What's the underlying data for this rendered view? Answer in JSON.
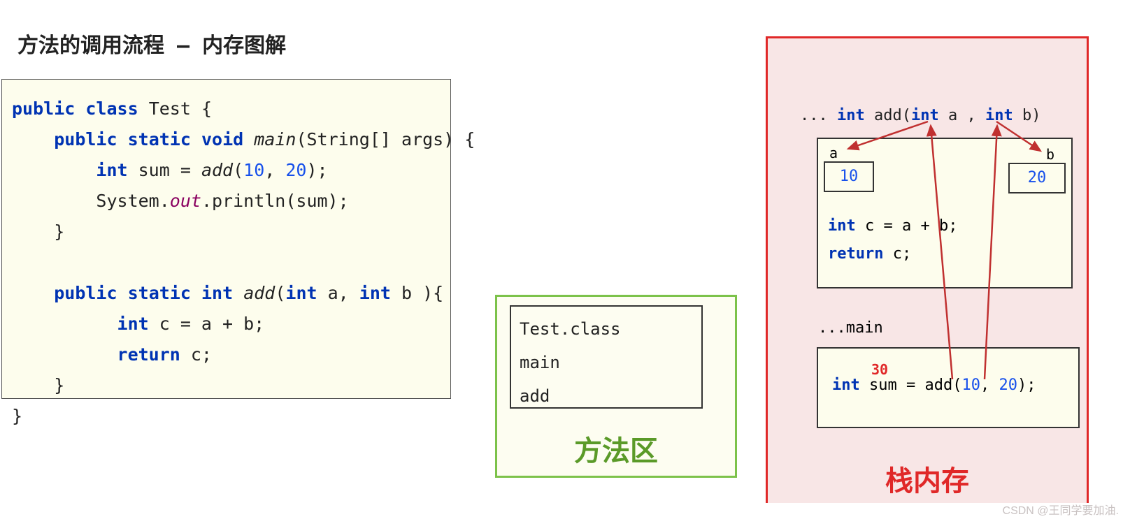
{
  "title": "方法的调用流程 – 内存图解",
  "code": {
    "l1_kw1": "public",
    "l1_kw2": "class",
    "l1_name": "Test {",
    "l2_kw1": "public",
    "l2_kw2": "static",
    "l2_kw3": "void",
    "l2_fn": "main",
    "l2_rest": "(String[] args) {",
    "l3_kw": "int",
    "l3_pre": " sum = ",
    "l3_fn": "add",
    "l3_open": "(",
    "l3_n1": "10",
    "l3_comma": ", ",
    "l3_n2": "20",
    "l3_close": ");",
    "l4_sys": "System.",
    "l4_out": "out",
    "l4_rest": ".println(sum);",
    "l5": "}",
    "l7_kw1": "public",
    "l7_kw2": "static",
    "l7_kw3": "int",
    "l7_fn": "add",
    "l7_open": "(",
    "l7_kw4": "int",
    "l7_a": " a, ",
    "l7_kw5": "int",
    "l7_b": " b ){",
    "l8_kw": "int",
    "l8_rest": " c = a + b;",
    "l9_kw": "return",
    "l9_rest": " c;",
    "l10": "}",
    "l11": "}"
  },
  "methodArea": {
    "class": "Test.class",
    "main": "main",
    "add": "add",
    "label": "方法区"
  },
  "stack": {
    "label": "栈内存",
    "addSig_pre": "... ",
    "addSig_kw1": "int",
    "addSig_name": " add(",
    "addSig_kw2": "int",
    "addSig_a": " a , ",
    "addSig_kw3": "int",
    "addSig_b": " b)",
    "aLabel": "a",
    "bLabel": "b",
    "aVal": "10",
    "bVal": "20",
    "addLine1_kw": "int",
    "addLine1_rest": " c = a + b;",
    "addLine2_kw": "return",
    "addLine2_rest": " c;",
    "mainLabel": "...main",
    "main_kw": "int",
    "main_pre": " sum = add(",
    "main_n1": "10",
    "main_comma": ", ",
    "main_n2": "20",
    "main_close": ");",
    "red30": "30"
  },
  "watermark": "CSDN @王同学要加油."
}
